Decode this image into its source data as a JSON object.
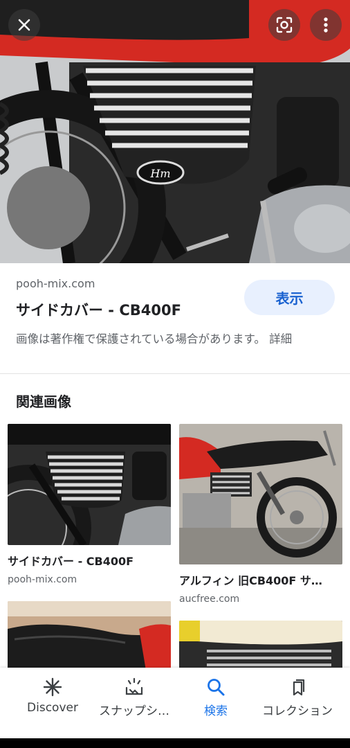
{
  "viewer": {
    "close_icon": "close-icon",
    "lens_icon": "google-lens-icon",
    "more_icon": "more-vert-icon",
    "hero_badge_text": "Hm"
  },
  "result": {
    "source": "pooh-mix.com",
    "title": "サイドカバー - CB400F",
    "view_button": "表示",
    "copyright_notice": "画像は著作権で保護されている場合があります。 詳細"
  },
  "related": {
    "heading": "関連画像",
    "items": [
      {
        "title": "サイドカバー - CB400F",
        "source": "pooh-mix.com"
      },
      {
        "title": "アルフィン 旧CB400F サ…",
        "source": "aucfree.com"
      },
      {
        "title": "",
        "source": ""
      },
      {
        "title": "",
        "source": ""
      }
    ]
  },
  "bottom_nav": {
    "items": [
      {
        "label": "Discover",
        "icon": "asterisk-icon",
        "active": false
      },
      {
        "label": "スナップシ…",
        "icon": "snapshot-icon",
        "active": false
      },
      {
        "label": "検索",
        "icon": "search-icon",
        "active": true
      },
      {
        "label": "コレクション",
        "icon": "collections-icon",
        "active": false
      }
    ]
  },
  "colors": {
    "accent_blue": "#1a73e8",
    "view_button_bg": "#e8f0fe",
    "tank_red": "#d42a22"
  }
}
